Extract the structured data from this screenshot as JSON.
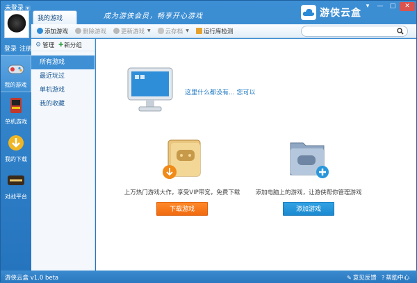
{
  "titlebar": {
    "login_status": "未登录",
    "tab_label": "我的游戏",
    "slogan": "成为游侠会员，畅享开心游戏",
    "brand_name": "游侠云盒"
  },
  "sidebar": {
    "login_link": "登录",
    "register_link": "注册",
    "items": [
      {
        "label": "我的游戏",
        "icon": "gamepad-icon"
      },
      {
        "label": "单机游戏",
        "icon": "arcade-icon"
      },
      {
        "label": "我的下载",
        "icon": "download-icon"
      },
      {
        "label": "对战平台",
        "icon": "battle-platform-icon"
      }
    ]
  },
  "toolbar": {
    "add_game": "添加游戏",
    "delete_game": "删除游戏",
    "update_game": "更新游戏",
    "cloud_save": "云存档",
    "runtime_check": "运行库检测",
    "search_placeholder": ""
  },
  "categories": {
    "manage_label": "管理",
    "new_group_label": "新分组",
    "items": [
      "所有游戏",
      "最近玩过",
      "单机游戏",
      "我的收藏"
    ],
    "active_index": 0
  },
  "main": {
    "empty_message": "这里什么都没有... 您可以",
    "left_card": {
      "description": "上万热门游戏大作，享受VIP带宽，免费下载",
      "button": "下载游戏"
    },
    "right_card": {
      "description": "添加电脑上的游戏，让游侠帮你管理游戏",
      "button": "添加游戏"
    }
  },
  "statusbar": {
    "version": "游侠云盒 v1.0 beta",
    "feedback": "意见反馈",
    "help": "帮助中心"
  },
  "colors": {
    "frame_blue": "#2a7fc4",
    "accent_orange": "#f06a10",
    "accent_blue": "#1b89cf",
    "active_category": "#3f8fd4"
  }
}
